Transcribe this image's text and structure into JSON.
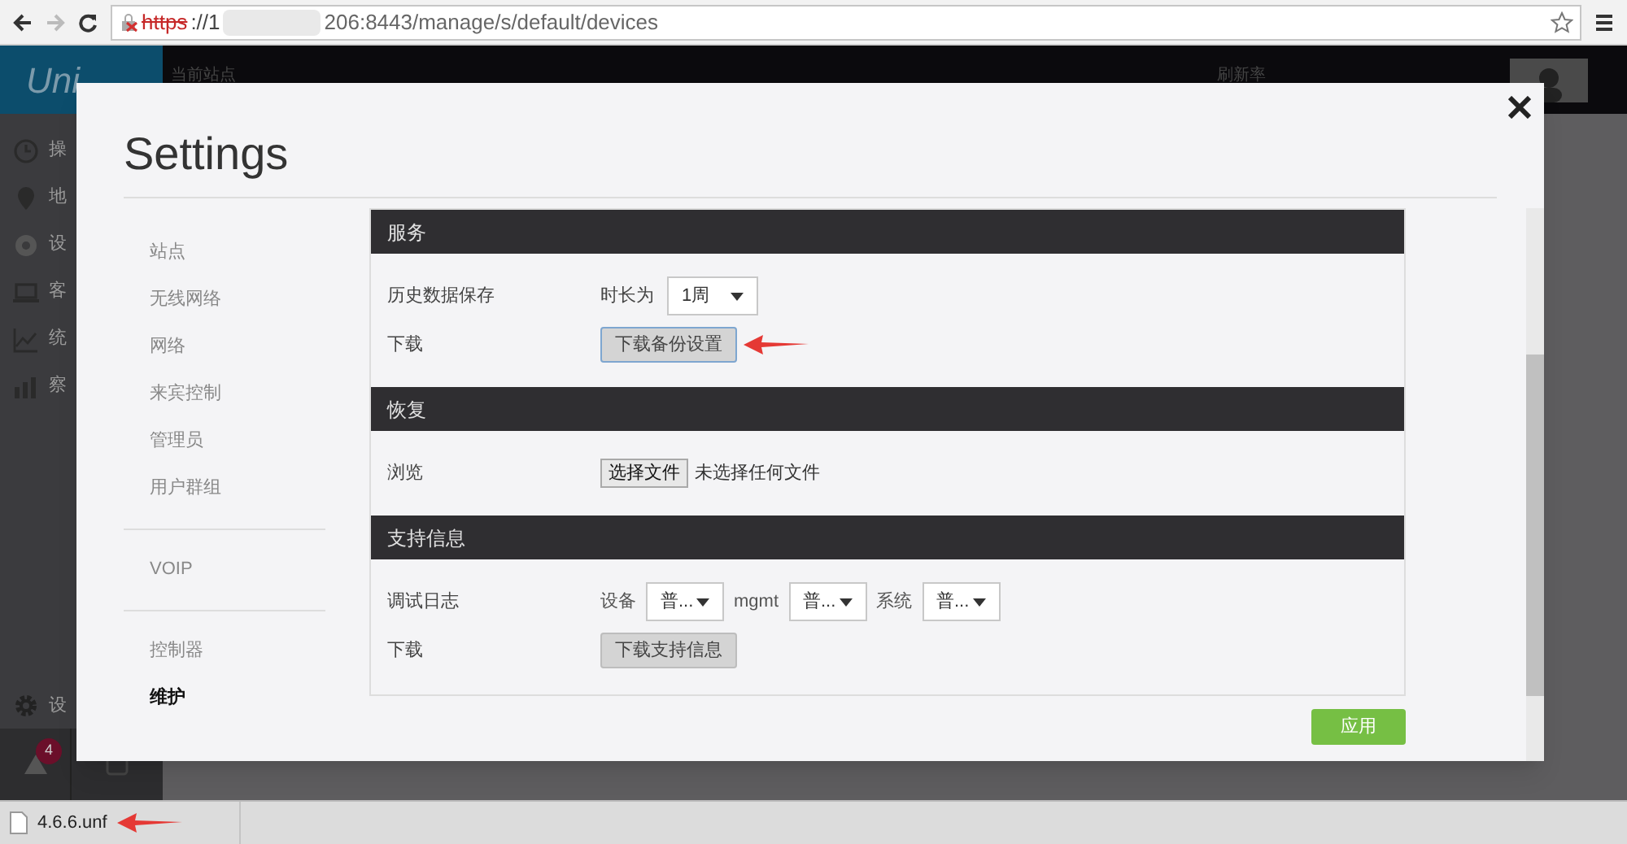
{
  "browser": {
    "scheme": "https",
    "url_start": "://1",
    "url_end": "206:8443/manage/s/default/devices"
  },
  "app": {
    "logo": "Uni",
    "top_bar": {
      "site_label": "当前站点",
      "refresh_label": "刷新率"
    },
    "sidebar": [
      {
        "label": "操"
      },
      {
        "label": "地"
      },
      {
        "label": "设"
      },
      {
        "label": "客"
      },
      {
        "label": "统"
      },
      {
        "label": "察"
      }
    ],
    "settings_item": {
      "label": "设"
    },
    "alerts_badge": "4"
  },
  "modal": {
    "title": "Settings",
    "nav_groups": [
      [
        {
          "label": "站点",
          "selected": false
        },
        {
          "label": "无线网络",
          "selected": false
        },
        {
          "label": "网络",
          "selected": false
        },
        {
          "label": "来宾控制",
          "selected": false
        },
        {
          "label": "管理员",
          "selected": false
        },
        {
          "label": "用户群组",
          "selected": false
        }
      ],
      [
        {
          "label": "VOIP",
          "selected": false
        }
      ],
      [
        {
          "label": "控制器",
          "selected": false
        },
        {
          "label": "维护",
          "selected": true
        }
      ]
    ],
    "sections": [
      {
        "title": "服务",
        "rows": [
          {
            "label": "历史数据保存",
            "kind": "select",
            "prefix": "时长为",
            "value": "1周"
          },
          {
            "label": "下载",
            "kind": "button",
            "button": "下载备份设置",
            "focused": true,
            "annotated": true
          }
        ]
      },
      {
        "title": "恢复",
        "rows": [
          {
            "label": "浏览",
            "kind": "file",
            "button": "选择文件",
            "note": "未选择任何文件"
          }
        ]
      },
      {
        "title": "支持信息",
        "rows": [
          {
            "label": "调试日志",
            "kind": "selects",
            "items": [
              {
                "label": "设备",
                "value": "普..."
              },
              {
                "label": "mgmt",
                "value": "普..."
              },
              {
                "label": "系统",
                "value": "普..."
              }
            ]
          },
          {
            "label": "下载",
            "kind": "button",
            "button": "下载支持信息",
            "focused": false,
            "annotated": false
          }
        ]
      }
    ],
    "apply_button": "应用"
  },
  "downloads": [
    {
      "file": "4.6.6.unf",
      "annotated": true
    }
  ]
}
